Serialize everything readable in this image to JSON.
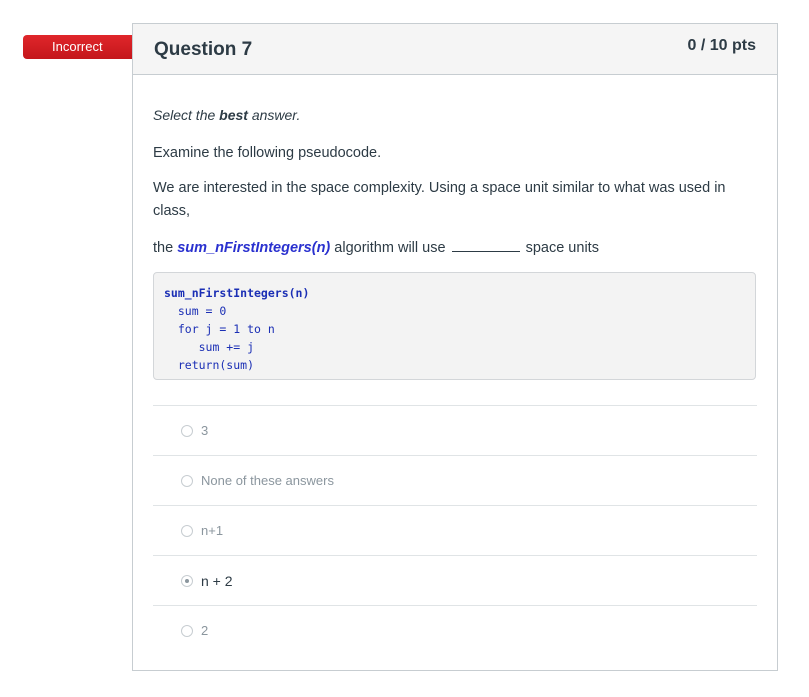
{
  "badge": {
    "label": "Incorrect"
  },
  "question": {
    "title": "Question 7",
    "points": "0 / 10 pts",
    "instruction_prefix": "Select the ",
    "instruction_bold": "best",
    "instruction_suffix": " answer.",
    "para1": "Examine the following pseudocode.",
    "para2": "We are interested in the space complexity. Using a space unit similar to what was used in class,",
    "para3_prefix": "the ",
    "para3_link": "sum_nFirstIntegers(n)",
    "para3_mid": " algorithm will use",
    "para3_suffix": " space units",
    "code": [
      "sum_nFirstIntegers(n)",
      "  sum = 0",
      "  for j = 1 to n",
      "     sum += j",
      "  return(sum)"
    ]
  },
  "answers": [
    {
      "label": "3",
      "selected": false
    },
    {
      "label": "None of these answers",
      "selected": false
    },
    {
      "label": "n+1",
      "selected": false
    },
    {
      "label": "n + 2",
      "selected": true
    },
    {
      "label": "2",
      "selected": false
    }
  ]
}
